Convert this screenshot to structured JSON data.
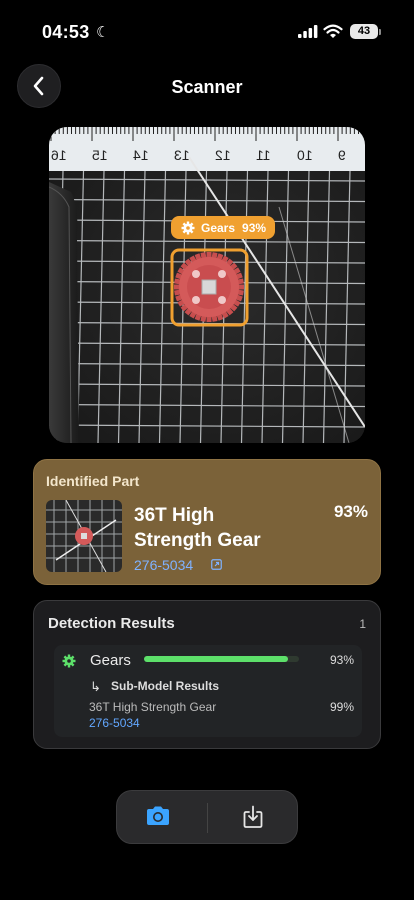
{
  "status": {
    "time": "04:53",
    "battery": "43"
  },
  "nav": {
    "title": "Scanner"
  },
  "detection_overlay": {
    "label": "Gears",
    "confidence": "93%"
  },
  "ruler": [
    "16",
    "15",
    "14",
    "13",
    "12",
    "11",
    "10",
    "9"
  ],
  "identified": {
    "header": "Identified Part",
    "name_line1": "36T High",
    "name_line2": "Strength Gear",
    "confidence": "93%",
    "part_number": "276-5034"
  },
  "detection": {
    "header": "Detection Results",
    "count": "1",
    "result": {
      "label": "Gears",
      "confidence": "93%",
      "progress": 0.93,
      "sub_header": "Sub-Model Results",
      "sub_name": "36T High Strength Gear",
      "sub_confidence": "99%",
      "sub_part_number": "276-5034"
    }
  },
  "colors": {
    "accent_gold": "#f0a030",
    "bar_green": "#5de06a",
    "link_blue": "#62a7ff",
    "card_brown": "#7b6239"
  },
  "icons": [
    "chevron-left-icon",
    "gear-icon",
    "external-link-icon",
    "camera-icon",
    "save-download-icon",
    "moon-icon",
    "signal-icon",
    "wifi-icon"
  ]
}
